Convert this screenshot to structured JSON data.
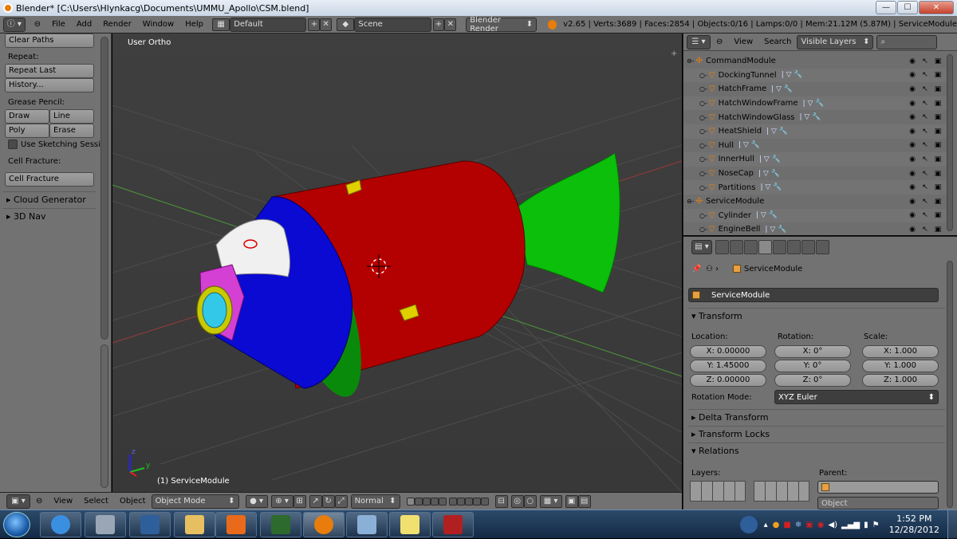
{
  "titlebar": {
    "title": "Blender* [C:\\Users\\Hlynkacg\\Documents\\UMMU_Apollo\\CSM.blend]",
    "minimize": "—",
    "maximize": "☐",
    "close": "✕"
  },
  "infobar": {
    "menus": [
      "File",
      "Add",
      "Render",
      "Window",
      "Help"
    ],
    "screen_layout": "Default",
    "scene": "Scene",
    "render_engine": "Blender Render",
    "stats": "v2.65 | Verts:3689 | Faces:2854 | Objects:0/16 | Lamps:0/0 | Mem:21.12M (5.87M) | ServiceModule"
  },
  "toolshelf": {
    "clear_paths": "Clear Paths",
    "repeat_label": "Repeat:",
    "repeat_last": "Repeat Last",
    "history": "History...",
    "grease_pencil_label": "Grease Pencil:",
    "draw": "Draw",
    "line": "Line",
    "poly": "Poly",
    "erase": "Erase",
    "sketching": "Use Sketching Sessio",
    "cell_fracture_label": "Cell Fracture:",
    "cell_fracture": "Cell Fracture",
    "cloud_generator": "Cloud Generator",
    "nav_3d": "3D Nav"
  },
  "viewport": {
    "view_label": "User Ortho",
    "object_label": "(1) ServiceModule",
    "axis_y": "y",
    "axis_z": "z"
  },
  "vpheader": {
    "menus": [
      "View",
      "Select",
      "Object"
    ],
    "mode": "Object Mode",
    "pivot": "Normal"
  },
  "outliner": {
    "view": "View",
    "search": "Search",
    "filter": "Visible Layers",
    "rows": [
      {
        "name": "CommandModule",
        "type": "empty",
        "indent": 0
      },
      {
        "name": "DockingTunnel",
        "type": "mesh",
        "indent": 1
      },
      {
        "name": "HatchFrame",
        "type": "mesh",
        "indent": 1
      },
      {
        "name": "HatchWindowFrame",
        "type": "mesh",
        "indent": 1
      },
      {
        "name": "HatchWindowGlass",
        "type": "mesh",
        "indent": 1
      },
      {
        "name": "HeatShield",
        "type": "mesh",
        "indent": 1
      },
      {
        "name": "Hull",
        "type": "mesh",
        "indent": 1
      },
      {
        "name": "InnerHull",
        "type": "mesh",
        "indent": 1
      },
      {
        "name": "NoseCap",
        "type": "mesh",
        "indent": 1
      },
      {
        "name": "Partitions",
        "type": "mesh",
        "indent": 1
      },
      {
        "name": "ServiceModule",
        "type": "empty",
        "indent": 0
      },
      {
        "name": "Cylinder",
        "type": "mesh",
        "indent": 1
      },
      {
        "name": "EngineBell",
        "type": "mesh",
        "indent": 1
      }
    ]
  },
  "props": {
    "breadcrumb": "ServiceModule",
    "object_name": "ServiceModule",
    "transform": "Transform",
    "location_label": "Location:",
    "rotation_label": "Rotation:",
    "scale_label": "Scale:",
    "loc_x": "X: 0.00000",
    "loc_y": "Y: 1.45000",
    "loc_z": "Z: 0.00000",
    "rot_x": "X: 0°",
    "rot_y": "Y: 0°",
    "rot_z": "Z: 0°",
    "scale_x": "X: 1.000",
    "scale_y": "Y: 1.000",
    "scale_z": "Z: 1.000",
    "rotation_mode_label": "Rotation Mode:",
    "rotation_mode": "XYZ Euler",
    "delta_transform": "Delta Transform",
    "transform_locks": "Transform Locks",
    "relations": "Relations",
    "layers_label": "Layers:",
    "parent_label": "Parent:",
    "object_field": "Object"
  },
  "taskbar": {
    "time": "1:52 PM",
    "date": "12/28/2012"
  },
  "colors": {
    "blender_orange": "#e87d0d",
    "sm_red": "#b30000",
    "cm_blue": "#0a0ad2",
    "bell_green": "#0bbf0b",
    "magenta": "#d43fd4"
  }
}
